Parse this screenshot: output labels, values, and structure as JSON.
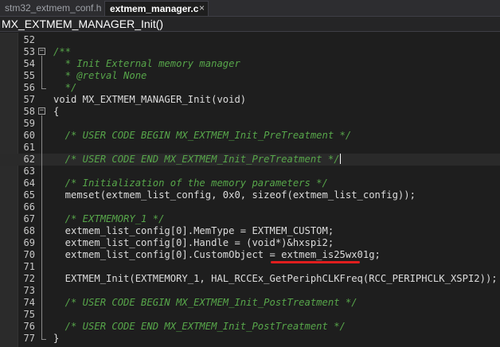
{
  "tabs": [
    {
      "label": "stm32_extmem_conf.h",
      "active": false
    },
    {
      "label": "extmem_manager.c",
      "active": true,
      "close": "×"
    }
  ],
  "function_bar": {
    "label": "MX_EXTMEM_MANAGER_Init()"
  },
  "lines": [
    {
      "n": "52",
      "text": ""
    },
    {
      "n": "53",
      "text": "/**",
      "kind": "comment",
      "fold": "−"
    },
    {
      "n": "54",
      "text": "  * Init External memory manager",
      "kind": "comment"
    },
    {
      "n": "55",
      "text": "  * @retval None",
      "kind": "comment"
    },
    {
      "n": "56",
      "text": "  */",
      "kind": "comment"
    },
    {
      "n": "57",
      "text": "void MX_EXTMEM_MANAGER_Init(void)"
    },
    {
      "n": "58",
      "text": "{",
      "fold": "−"
    },
    {
      "n": "59",
      "text": ""
    },
    {
      "n": "60",
      "text": "  /* USER CODE BEGIN MX_EXTMEM_Init_PreTreatment */",
      "kind": "comment"
    },
    {
      "n": "61",
      "text": ""
    },
    {
      "n": "62",
      "text": "  /* USER CODE END MX_EXTMEM_Init_PreTreatment */",
      "kind": "comment",
      "highlight": true
    },
    {
      "n": "63",
      "text": ""
    },
    {
      "n": "64",
      "text": "  /* Initialization of the memory parameters */",
      "kind": "comment"
    },
    {
      "n": "65",
      "text": "  memset(extmem_list_config, 0x0, sizeof(extmem_list_config));"
    },
    {
      "n": "66",
      "text": ""
    },
    {
      "n": "67",
      "text": "  /* EXTMEMORY_1 */",
      "kind": "comment"
    },
    {
      "n": "68",
      "text": "  extmem_list_config[0].MemType = EXTMEM_CUSTOM;"
    },
    {
      "n": "69",
      "text": "  extmem_list_config[0].Handle = (void*)&hxspi2;"
    },
    {
      "n": "70",
      "text": "  extmem_list_config[0].CustomObject = extmem_is25wx01g;"
    },
    {
      "n": "71",
      "text": ""
    },
    {
      "n": "72",
      "text": "  EXTMEM_Init(EXTMEMORY_1, HAL_RCCEx_GetPeriphCLKFreq(RCC_PERIPHCLK_XSPI2));"
    },
    {
      "n": "73",
      "text": ""
    },
    {
      "n": "74",
      "text": "  /* USER CODE BEGIN MX_EXTMEM_Init_PostTreatment */",
      "kind": "comment"
    },
    {
      "n": "75",
      "text": ""
    },
    {
      "n": "76",
      "text": "  /* USER CODE END MX_EXTMEM_Init_PostTreatment */",
      "kind": "comment"
    },
    {
      "n": "77",
      "text": "}"
    }
  ],
  "colors": {
    "background": "#1e1e1e",
    "comment": "#57a64a",
    "code": "#dcdcdc",
    "underline": "#e01e1e"
  }
}
